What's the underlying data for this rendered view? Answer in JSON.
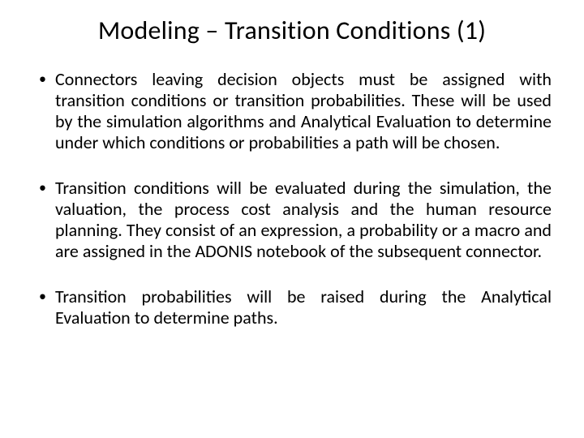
{
  "slide": {
    "title": "Modeling – Transition Conditions (1)",
    "bullets": [
      "Connectors leaving decision objects must be assigned with transition conditions or transition probabilities. These will be used by the simulation algorithms and Analytical Evaluation to determine under which conditions or probabilities a path will be chosen.",
      "Transition conditions will be evaluated during the simulation, the valuation, the process cost analysis and the human resource planning. They consist of an expression, a probability or a macro and are assigned in the ADONIS notebook of the subsequent connector.",
      "Transition probabilities will be raised during the Analytical Evaluation to determine paths."
    ]
  }
}
